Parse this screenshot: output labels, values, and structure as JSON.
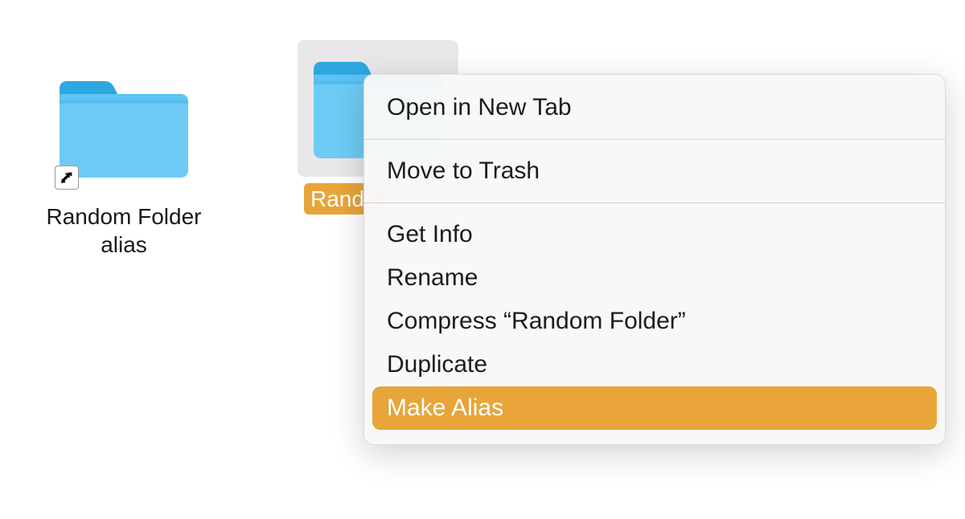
{
  "icons": {
    "alias": {
      "label": "Random Folder alias",
      "is_alias": true,
      "selected": false
    },
    "folder": {
      "label": "Random Folder",
      "label_visible": "Rando",
      "is_alias": false,
      "selected": true
    }
  },
  "context_menu": {
    "open_new_tab": "Open in New Tab",
    "move_to_trash": "Move to Trash",
    "get_info": "Get Info",
    "rename": "Rename",
    "compress": "Compress “Random Folder”",
    "duplicate": "Duplicate",
    "make_alias": "Make Alias",
    "highlighted": "make_alias"
  },
  "colors": {
    "selection": "#e7a53a",
    "folder_primary": "#5bc4f3",
    "folder_tab": "#2ea7e0"
  }
}
